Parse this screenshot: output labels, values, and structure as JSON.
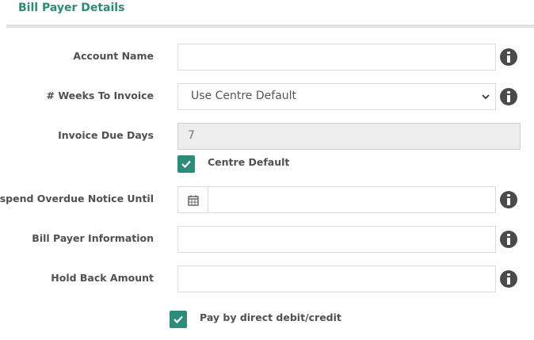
{
  "section": {
    "title": "Bill Payer Details"
  },
  "fields": {
    "account_name": {
      "label": "Account Name",
      "value": ""
    },
    "weeks_to_invoice": {
      "label": "# Weeks To Invoice",
      "value": "Use Centre Default"
    },
    "invoice_due_days": {
      "label": "Invoice Due Days",
      "value": "7"
    },
    "centre_default": {
      "label": "Centre Default",
      "checked": true
    },
    "suspend_overdue": {
      "label": "Suspend Overdue Notice Until",
      "value": ""
    },
    "bill_payer_info": {
      "label": "Bill Payer Information",
      "value": ""
    },
    "hold_back_amount": {
      "label": "Hold Back Amount",
      "value": ""
    },
    "direct_debit": {
      "label": "Pay by direct debit/credit",
      "checked": true
    }
  },
  "icons": {
    "info": "info-circle-icon",
    "calendar": "calendar-icon",
    "check": "check-icon",
    "chevron": "chevron-down-icon"
  },
  "colors": {
    "accent": "#2e8a77",
    "checkbox": "#2f8a7a",
    "info_icon": "#4a4a4a",
    "readonly_bg": "#ededed"
  }
}
